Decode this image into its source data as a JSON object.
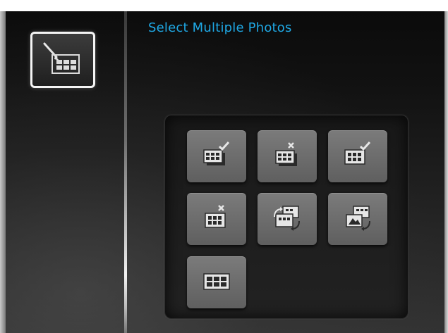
{
  "screen": {
    "title": "Select Multiple Photos",
    "title_color": "#1fa9e6"
  },
  "sidebar": {
    "selected_item_icon": "multi-select-pencil-icon"
  },
  "options": [
    {
      "icon": "select-check-stack-icon"
    },
    {
      "icon": "deselect-x-stack-icon"
    },
    {
      "icon": "select-all-check-icon"
    },
    {
      "icon": "deselect-all-x-icon"
    },
    {
      "icon": "rotate-photos-icon"
    },
    {
      "icon": "rotate-photo-landscape-icon"
    },
    {
      "icon": "thumbnail-grid-icon"
    }
  ]
}
